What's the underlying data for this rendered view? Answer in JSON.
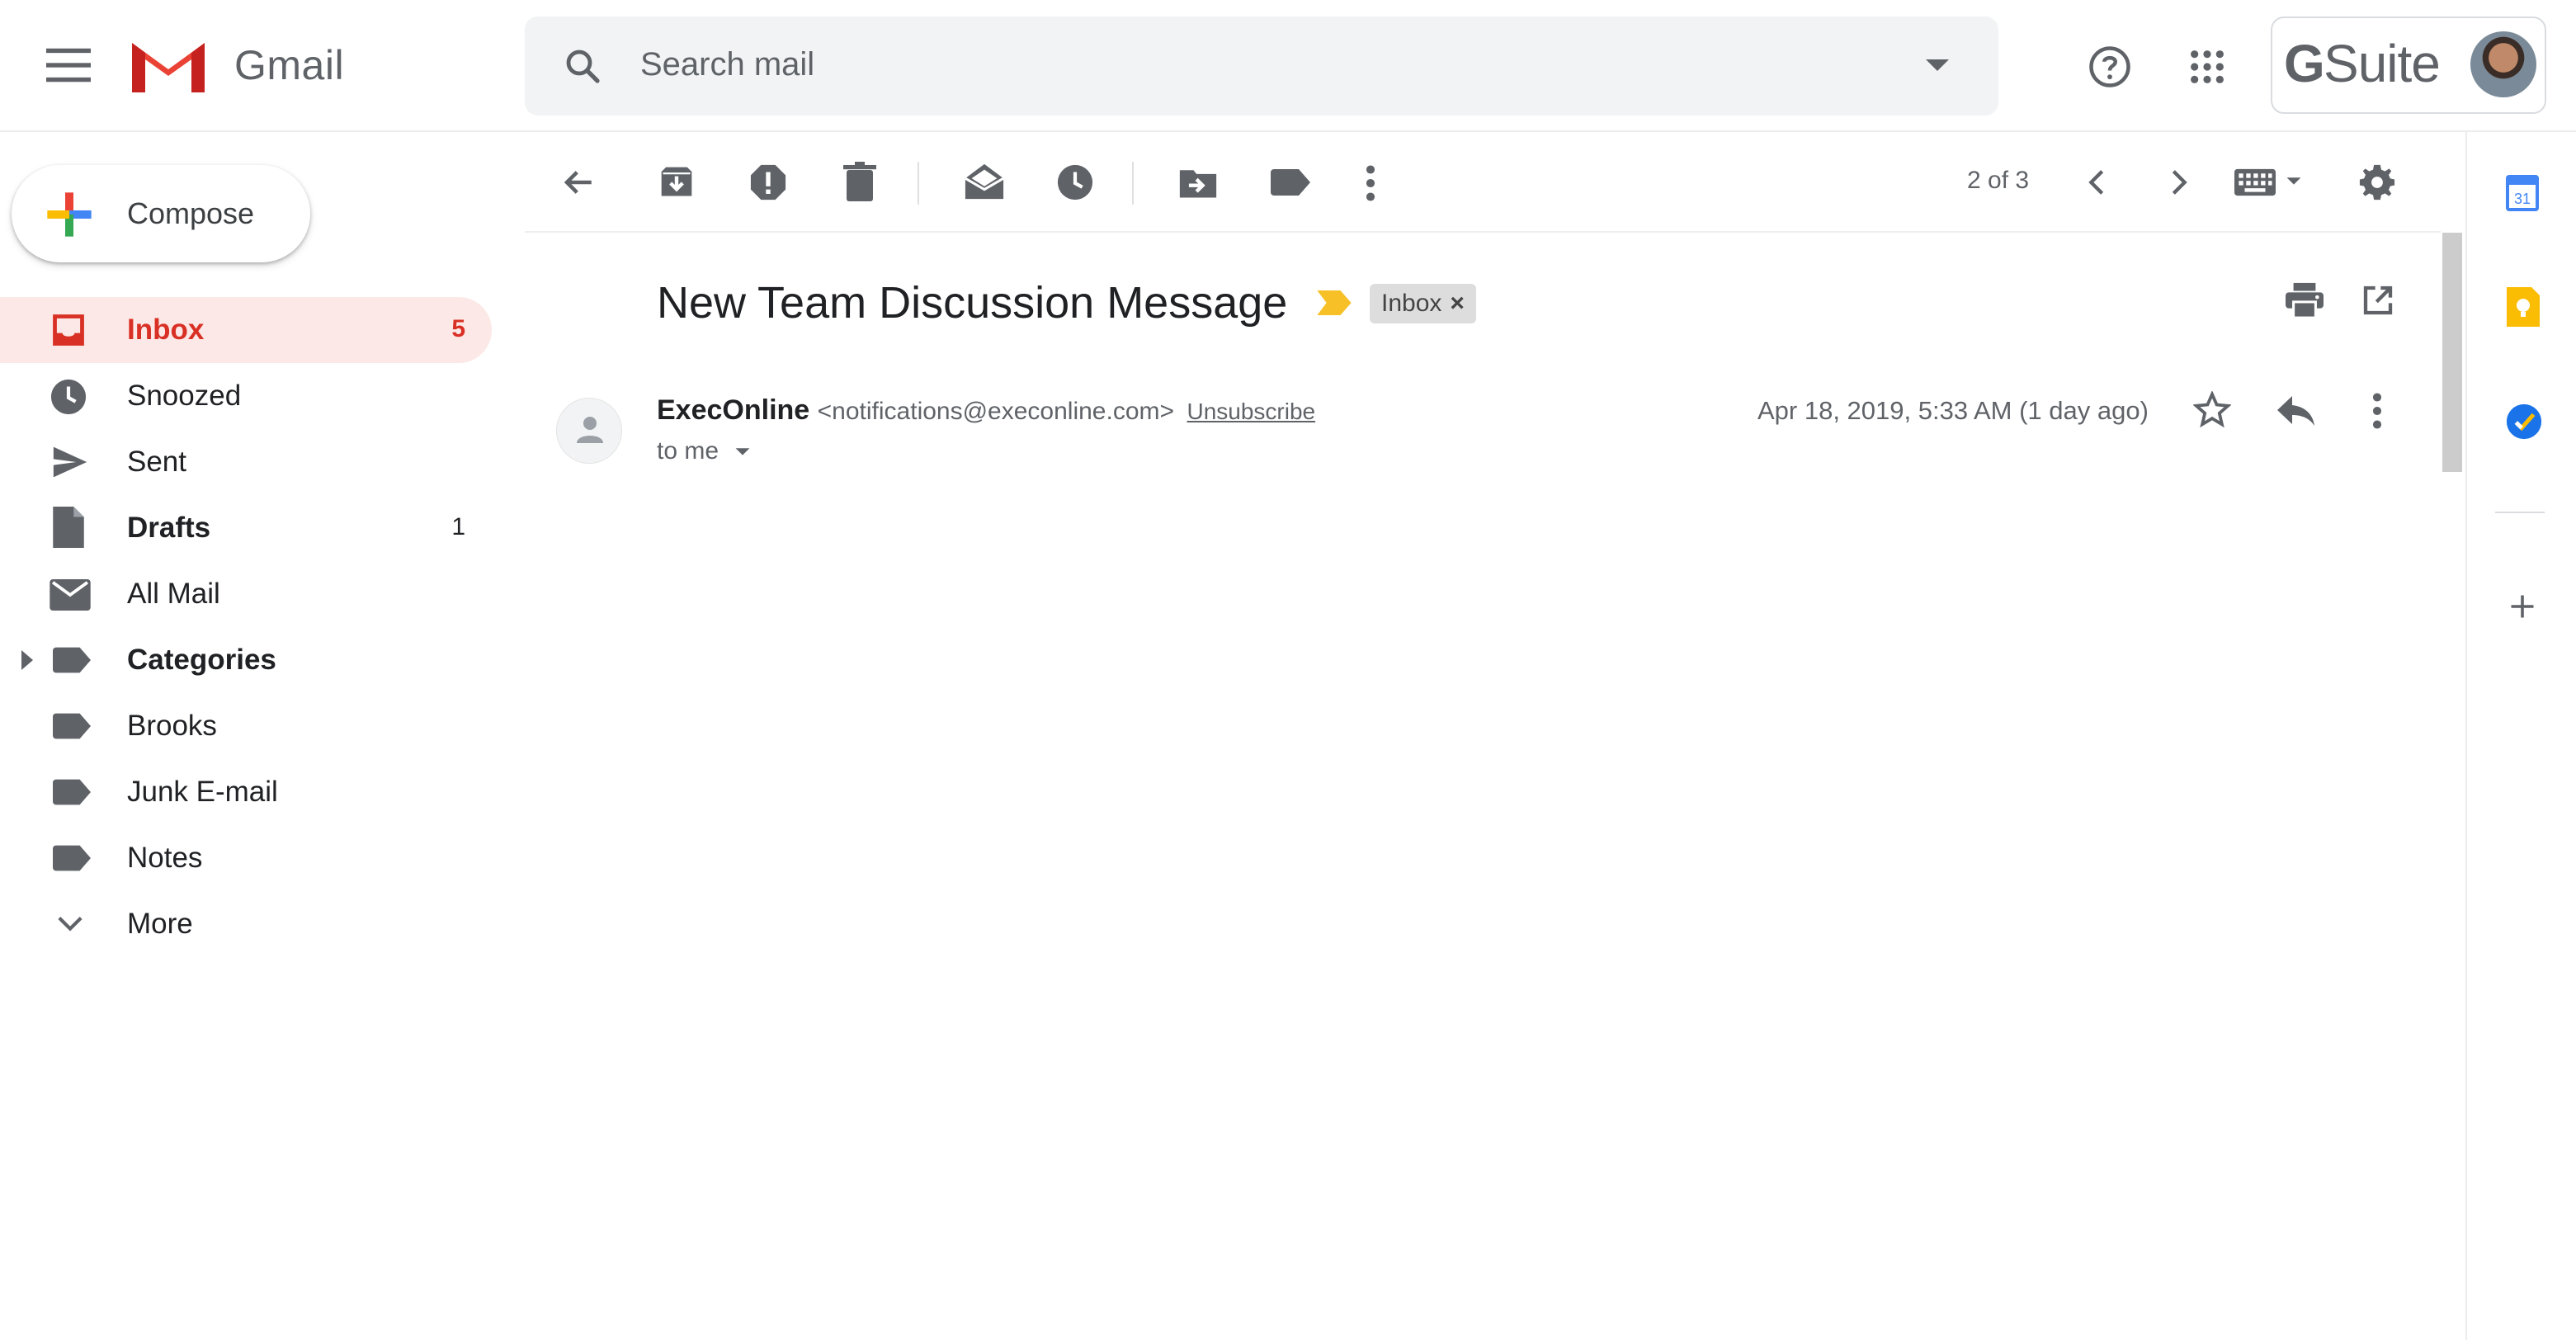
{
  "app": {
    "name": "Gmail"
  },
  "header": {
    "search_placeholder": "Search mail",
    "gsuite_label": "Suite",
    "gsuite_g": "G"
  },
  "sidebar": {
    "compose_label": "Compose",
    "items": [
      {
        "label": "Inbox",
        "count": "5",
        "icon": "inbox-icon",
        "active": true,
        "bold": true
      },
      {
        "label": "Snoozed",
        "count": "",
        "icon": "clock-icon"
      },
      {
        "label": "Sent",
        "count": "",
        "icon": "send-icon"
      },
      {
        "label": "Drafts",
        "count": "1",
        "icon": "draft-icon",
        "bold": true
      },
      {
        "label": "All Mail",
        "count": "",
        "icon": "mail-icon"
      },
      {
        "label": "Categories",
        "count": "",
        "icon": "label-icon",
        "bold": true,
        "expandable": true
      },
      {
        "label": "Brooks",
        "count": "",
        "icon": "label-icon"
      },
      {
        "label": "Junk E-mail",
        "count": "",
        "icon": "label-icon"
      },
      {
        "label": "Notes",
        "count": "",
        "icon": "label-icon"
      },
      {
        "label": "More",
        "count": "",
        "icon": "chevron-down-icon"
      }
    ]
  },
  "toolbar": {
    "pagination": "2 of 3"
  },
  "message": {
    "subject": "New Team Discussion Message",
    "label_chip": "Inbox",
    "label_chip_close": "×",
    "sender_name": "ExecOnline",
    "sender_email": "<notifications@execonline.com>",
    "unsubscribe": "Unsubscribe",
    "recipient": "to me",
    "date": "Apr 18, 2019, 5:33 AM (1 day ago)"
  },
  "right_panel": {
    "calendar_day": "31"
  },
  "colors": {
    "accent_red": "#d93025",
    "active_bg": "#fce8e6",
    "icon_gray": "#5f6368",
    "importance_yellow": "#f6c026",
    "calendar_blue": "#4285f4",
    "keep_yellow": "#fbbc04",
    "tasks_blue": "#1a73e8"
  }
}
